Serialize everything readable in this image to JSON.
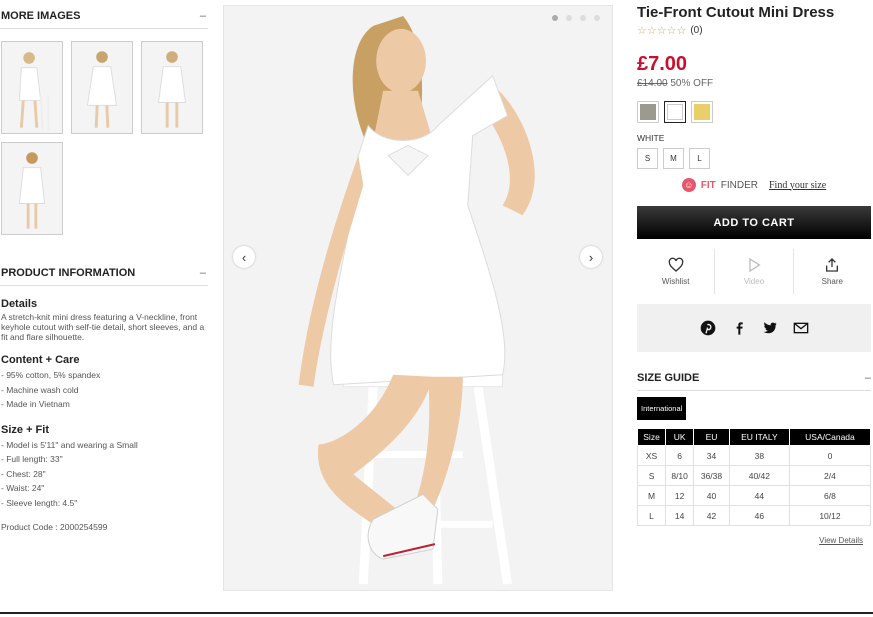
{
  "left": {
    "more_images_title": "MORE IMAGES",
    "more_images_toggle": "–",
    "product_info_title": "PRODUCT INFORMATION",
    "product_info_toggle": "–",
    "details_heading": "Details",
    "details_text": "A stretch-knit mini dress featuring a V-neckline, front keyhole cutout with self-tie detail, short sleeves, and a fit and flare silhouette.",
    "content_heading": "Content + Care",
    "content_items": [
      "- 95% cotton, 5% spandex",
      "- Machine wash cold",
      "- Made in Vietnam"
    ],
    "size_heading": "Size + Fit",
    "size_items": [
      "- Model is 5'11\" and wearing a Small",
      "- Full length: 33\"",
      "- Chest: 28\"",
      "- Waist: 24\"",
      "- Sleeve length: 4.5\""
    ],
    "product_code": "Product Code : 2000254599"
  },
  "gallery": {
    "prev_icon": "‹",
    "next_icon": "›"
  },
  "product": {
    "title": "Tie-Front Cutout Mini Dress",
    "stars": "☆☆☆☆☆",
    "rating_count": "(0)",
    "price": "£7.00",
    "old_price": "£14.00",
    "discount": "50% OFF",
    "swatches": [
      {
        "name": "grey-swatch",
        "color": "#9a9a8e"
      },
      {
        "name": "white-swatch",
        "color": "#ffffff"
      },
      {
        "name": "yellow-swatch",
        "color": "#e9cf6a"
      }
    ],
    "color_name": "WHITE",
    "sizes": [
      "S",
      "M",
      "L"
    ],
    "fit_label": "FIT",
    "finder_label": "FINDER",
    "find_size_link": "Find your size",
    "add_to_cart": "ADD TO CART",
    "wishlist_label": "Wishlist",
    "video_label": "Video",
    "share_label": "Share"
  },
  "size_guide": {
    "title": "SIZE GUIDE",
    "toggle": "–",
    "tab": "International",
    "headers": [
      "Size",
      "UK",
      "EU",
      "EU ITALY",
      "USA/Canada"
    ],
    "rows": [
      [
        "XS",
        "6",
        "34",
        "38",
        "0"
      ],
      [
        "S",
        "8/10",
        "36/38",
        "40/42",
        "2/4"
      ],
      [
        "M",
        "12",
        "40",
        "44",
        "6/8"
      ],
      [
        "L",
        "14",
        "42",
        "46",
        "10/12"
      ]
    ],
    "view_details": "View Details"
  }
}
